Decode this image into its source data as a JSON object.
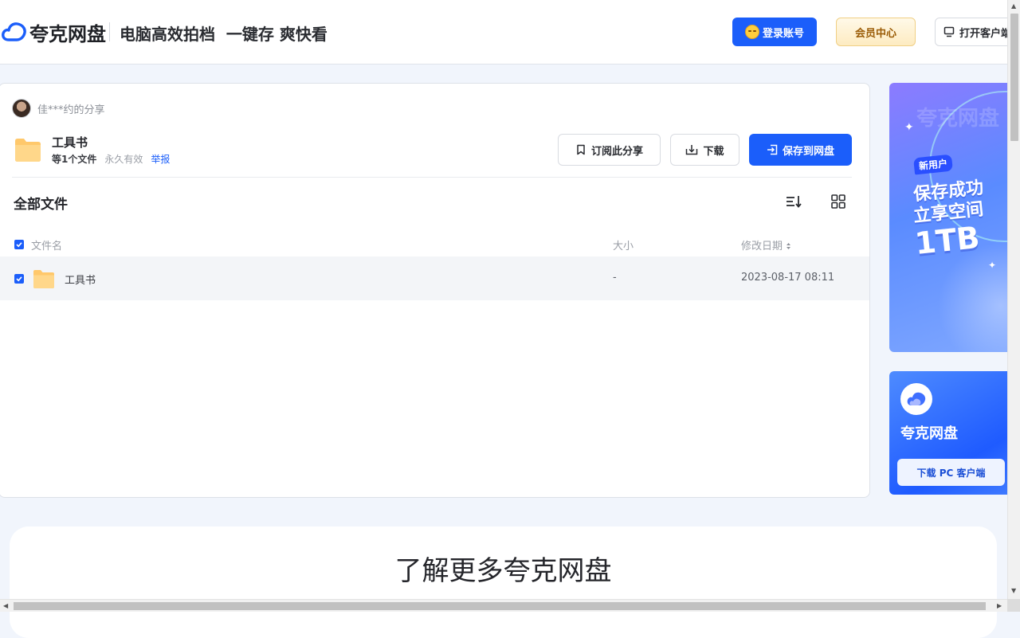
{
  "header": {
    "logo_text": "夸克网盘",
    "slogan": "电脑高效拍档  一键存 爽快看",
    "login_label": "登录账号",
    "vip_label": "会员中心",
    "client_label": "打开客户端"
  },
  "share": {
    "sharer": "佳***约的分享",
    "title": "工具书",
    "file_count": "等1个文件",
    "validity": "永久有效",
    "report_label": "举报",
    "subscribe_label": "订阅此分享",
    "download_label": "下载",
    "save_label": "保存到网盘"
  },
  "files": {
    "section_title": "全部文件",
    "columns": {
      "name": "文件名",
      "size": "大小",
      "modified": "修改日期"
    },
    "rows": [
      {
        "name": "工具书",
        "size": "-",
        "modified": "2023-08-17 08:11",
        "checked": true
      }
    ]
  },
  "ads": {
    "promo": {
      "tag": "新用户",
      "line1": "保存成功",
      "line2": "立享空间",
      "amount": "1TB",
      "watermark": "夸克网盘"
    },
    "client": {
      "title": "夸克网盘",
      "button_label": "下载 PC 客户端"
    }
  },
  "bottom": {
    "title": "了解更多夸克网盘"
  },
  "colors": {
    "brand": "#1b5efa",
    "vip_text": "#9a5b06",
    "folder": "#ffc86b"
  }
}
